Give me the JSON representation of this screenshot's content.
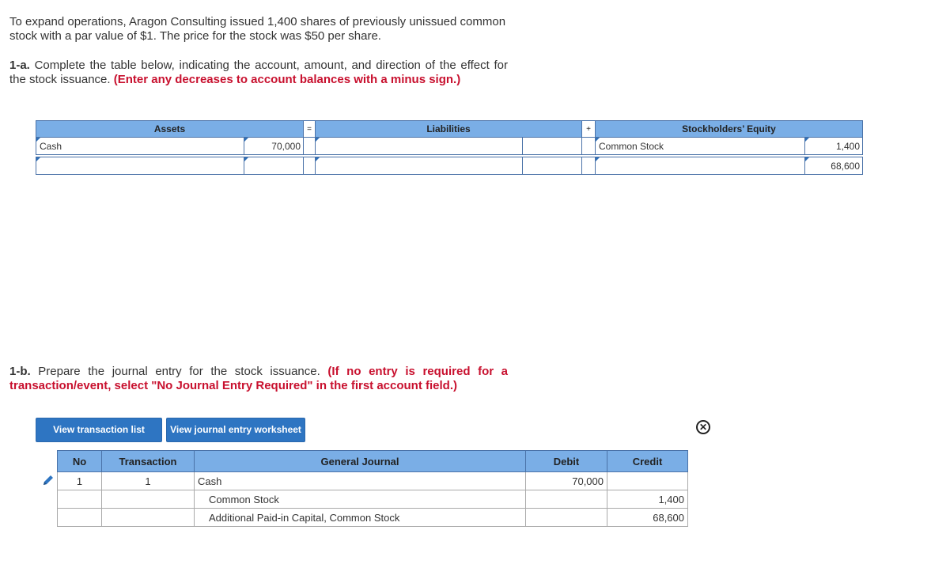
{
  "intro": "To expand operations, Aragon Consulting issued 1,400 shares of previously unissued common stock with a par value of $1. The price for the stock was $50 per share.",
  "q1a": {
    "number": "1-a.",
    "text": "Complete the table below, indicating the account, amount, and direction of the effect for the stock issuance.",
    "instruction": "(Enter any decreases to account balances with a minus sign.)"
  },
  "equation": {
    "headers": {
      "assets": "Assets",
      "equals": "=",
      "liabilities": "Liabilities",
      "plus": "+",
      "equity": "Stockholders’ Equity"
    },
    "rows": [
      {
        "asset_account": "Cash",
        "asset_amount": "70,000",
        "liab_account": "",
        "liab_amount": "",
        "equity_account": "Common Stock",
        "equity_amount": "1,400"
      },
      {
        "asset_account": "",
        "asset_amount": "",
        "liab_account": "",
        "liab_amount": "",
        "equity_account": "",
        "equity_amount": "68,600"
      }
    ]
  },
  "q1b": {
    "number": "1-b.",
    "text": "Prepare the journal entry for the stock issuance.",
    "instruction": "(If no entry is required for a transaction/event, select \"No Journal Entry Required\" in the first account field.)"
  },
  "buttons": {
    "view_transactions": "View transaction list",
    "view_worksheet": "View journal entry worksheet"
  },
  "icons": {
    "close": "close-circle-icon",
    "edit": "pencil-icon"
  },
  "journal": {
    "headers": {
      "no": "No",
      "transaction": "Transaction",
      "general_journal": "General Journal",
      "debit": "Debit",
      "credit": "Credit"
    },
    "rows": [
      {
        "no": "1",
        "transaction": "1",
        "account": "Cash",
        "debit": "70,000",
        "credit": ""
      },
      {
        "no": "",
        "transaction": "",
        "account": "Common Stock",
        "debit": "",
        "credit": "1,400"
      },
      {
        "no": "",
        "transaction": "",
        "account": "Additional Paid-in Capital, Common Stock",
        "debit": "",
        "credit": "68,600"
      }
    ]
  },
  "colors": {
    "header_bg": "#7aaee6",
    "button_bg": "#2e75c2",
    "instruction_red": "#c8102e"
  }
}
